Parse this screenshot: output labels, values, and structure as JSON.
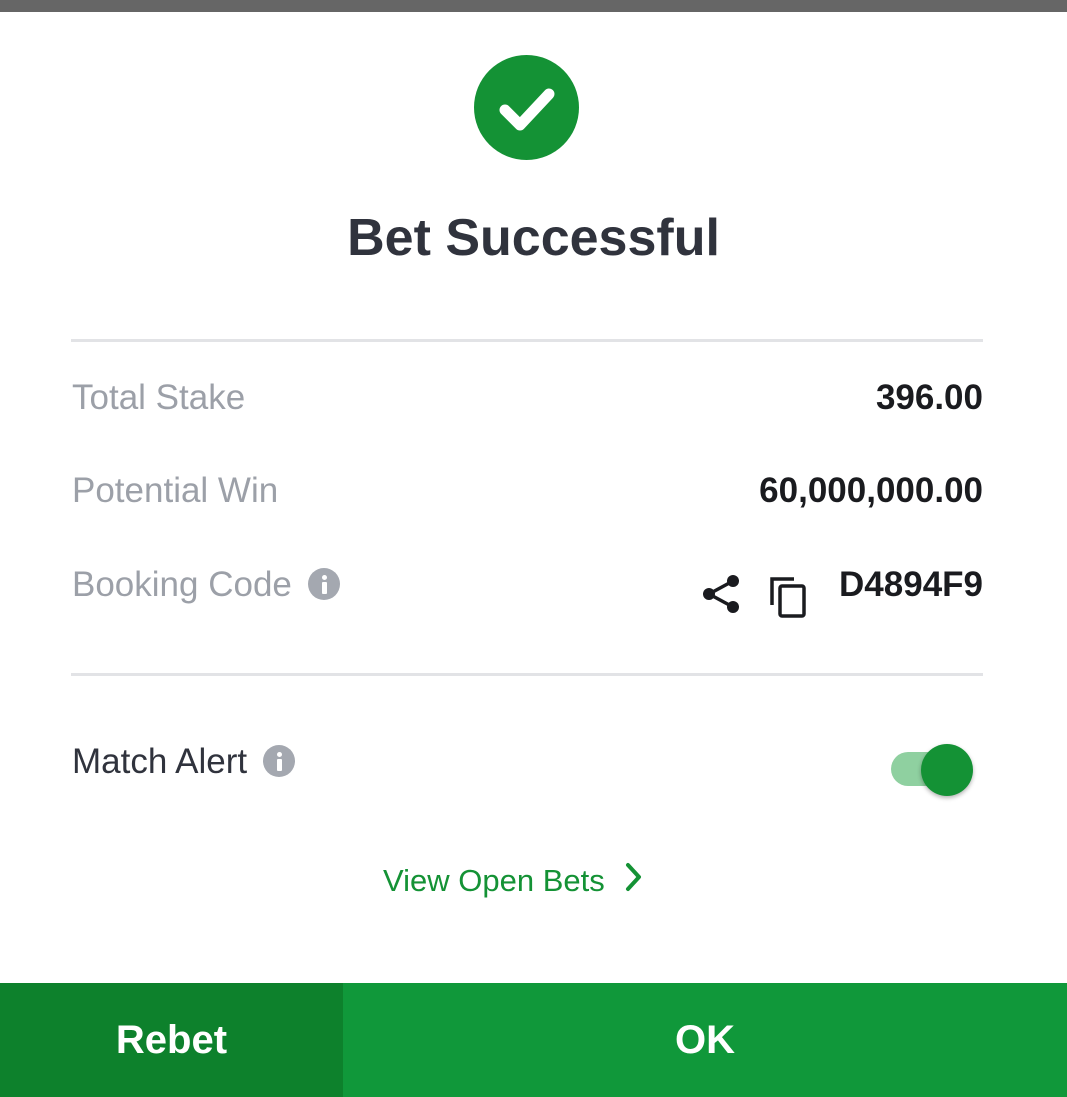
{
  "dialog": {
    "title": "Bet Successful",
    "icon": "check-circle-icon",
    "accent_color": "#149235"
  },
  "details": {
    "total_stake_label": "Total Stake",
    "total_stake_value": "396.00",
    "potential_win_label": "Potential Win",
    "potential_win_value": "60,000,000.00",
    "booking_code_label": "Booking Code",
    "booking_code_value": "D4894F9"
  },
  "match_alert": {
    "label": "Match Alert",
    "enabled": true
  },
  "links": {
    "view_open_bets": "View Open Bets"
  },
  "buttons": {
    "rebet": "Rebet",
    "ok": "OK"
  }
}
